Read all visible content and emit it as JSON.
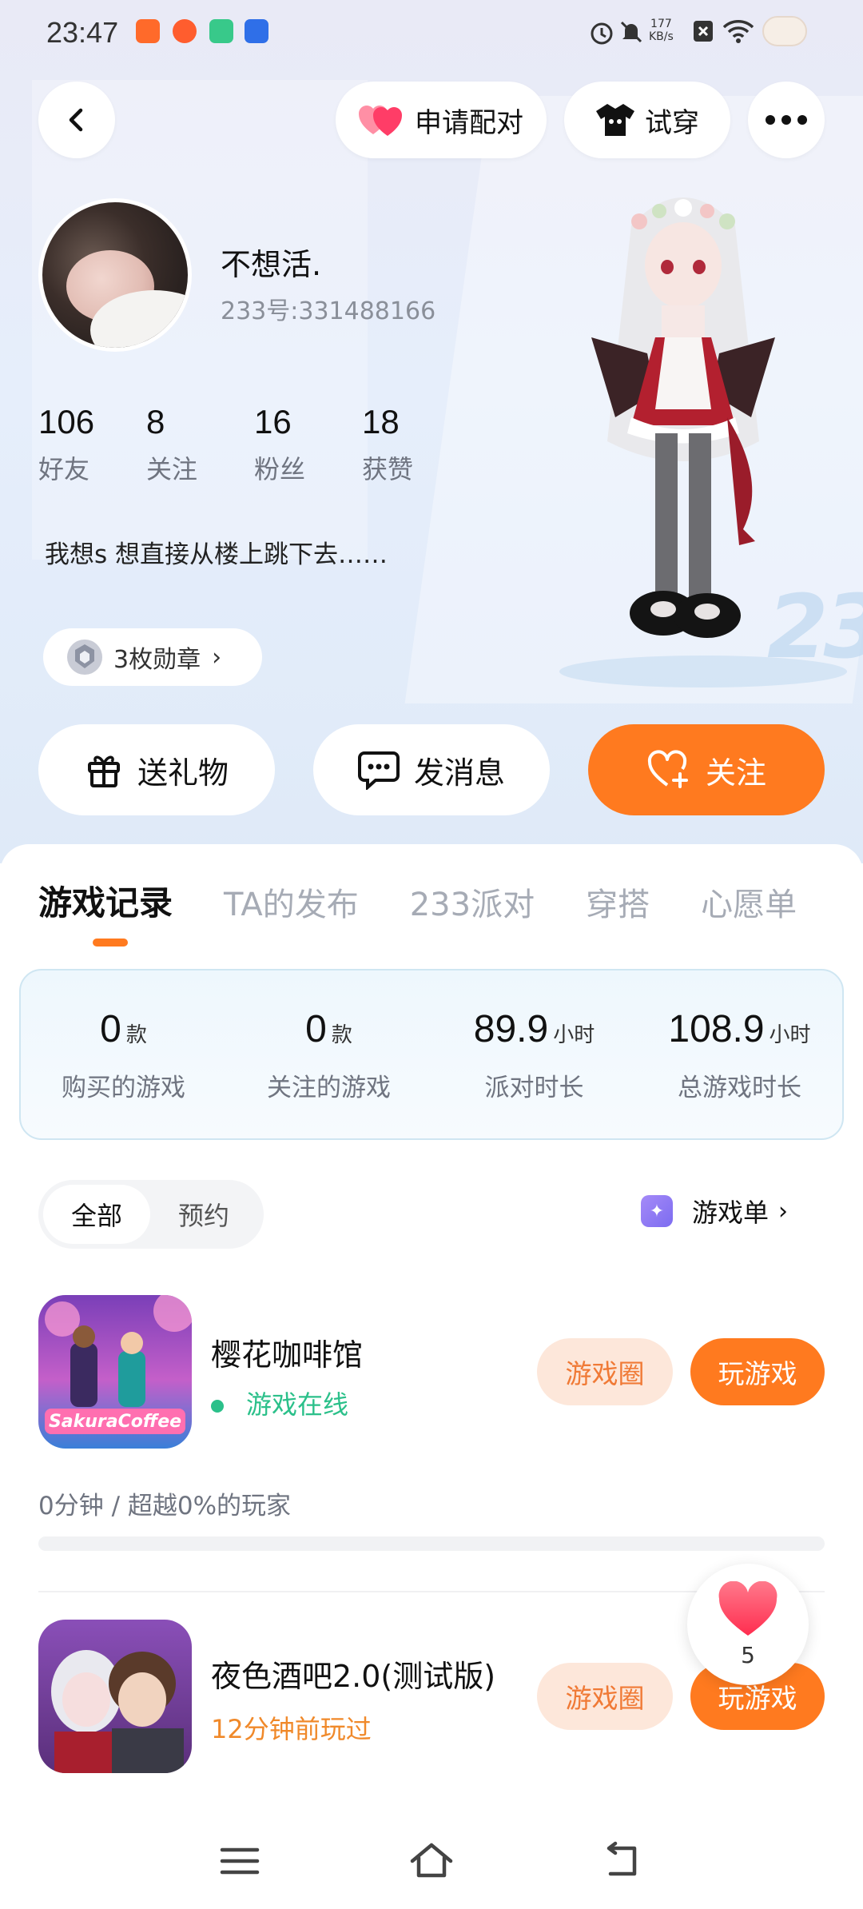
{
  "status_bar": {
    "time": "23:47",
    "net_speed": "177",
    "net_unit": "KB/s",
    "icons": [
      "alarm-icon",
      "mute-icon",
      "close-box-icon",
      "wifi-icon",
      "battery-icon"
    ]
  },
  "top_actions": {
    "pair_label": "申请配对",
    "try_label": "试穿"
  },
  "profile": {
    "nickname": "不想活.",
    "uid": "233号:331488166",
    "stats": [
      {
        "value": "106",
        "label": "好友"
      },
      {
        "value": "8",
        "label": "关注"
      },
      {
        "value": "16",
        "label": "粉丝"
      },
      {
        "value": "18",
        "label": "获赞"
      }
    ],
    "bio": "我想s  想直接从楼上跳下去……",
    "medal_label": "3枚勋章"
  },
  "actions": {
    "gift": "送礼物",
    "message": "发消息",
    "follow": "关注"
  },
  "tabs": [
    "游戏记录",
    "TA的发布",
    "233派对",
    "穿搭",
    "心愿单"
  ],
  "summary": [
    {
      "value": "0",
      "unit": "款",
      "label": "购买的游戏"
    },
    {
      "value": "0",
      "unit": "款",
      "label": "关注的游戏"
    },
    {
      "value": "89.9",
      "unit": "小时",
      "label": "派对时长"
    },
    {
      "value": "108.9",
      "unit": "小时",
      "label": "总游戏时长"
    }
  ],
  "filter": {
    "options": [
      "全部",
      "预约"
    ],
    "selected": "全部",
    "game_list_label": "游戏单"
  },
  "games": [
    {
      "title": "樱花咖啡馆",
      "status": "游戏在线",
      "progress_text": "0分钟 / 超越0%的玩家",
      "circle_label": "游戏圈",
      "play_label": "玩游戏",
      "thumb_text": "SakuraCoffee"
    },
    {
      "title": "夜色酒吧2.0(测试版)",
      "status": "12分钟前玩过",
      "circle_label": "游戏圈",
      "play_label": "玩游戏"
    }
  ],
  "like": {
    "count": "5"
  },
  "colors": {
    "accent": "#ff7a1f",
    "online": "#2bc08a",
    "circle_bg": "#fde7da"
  }
}
